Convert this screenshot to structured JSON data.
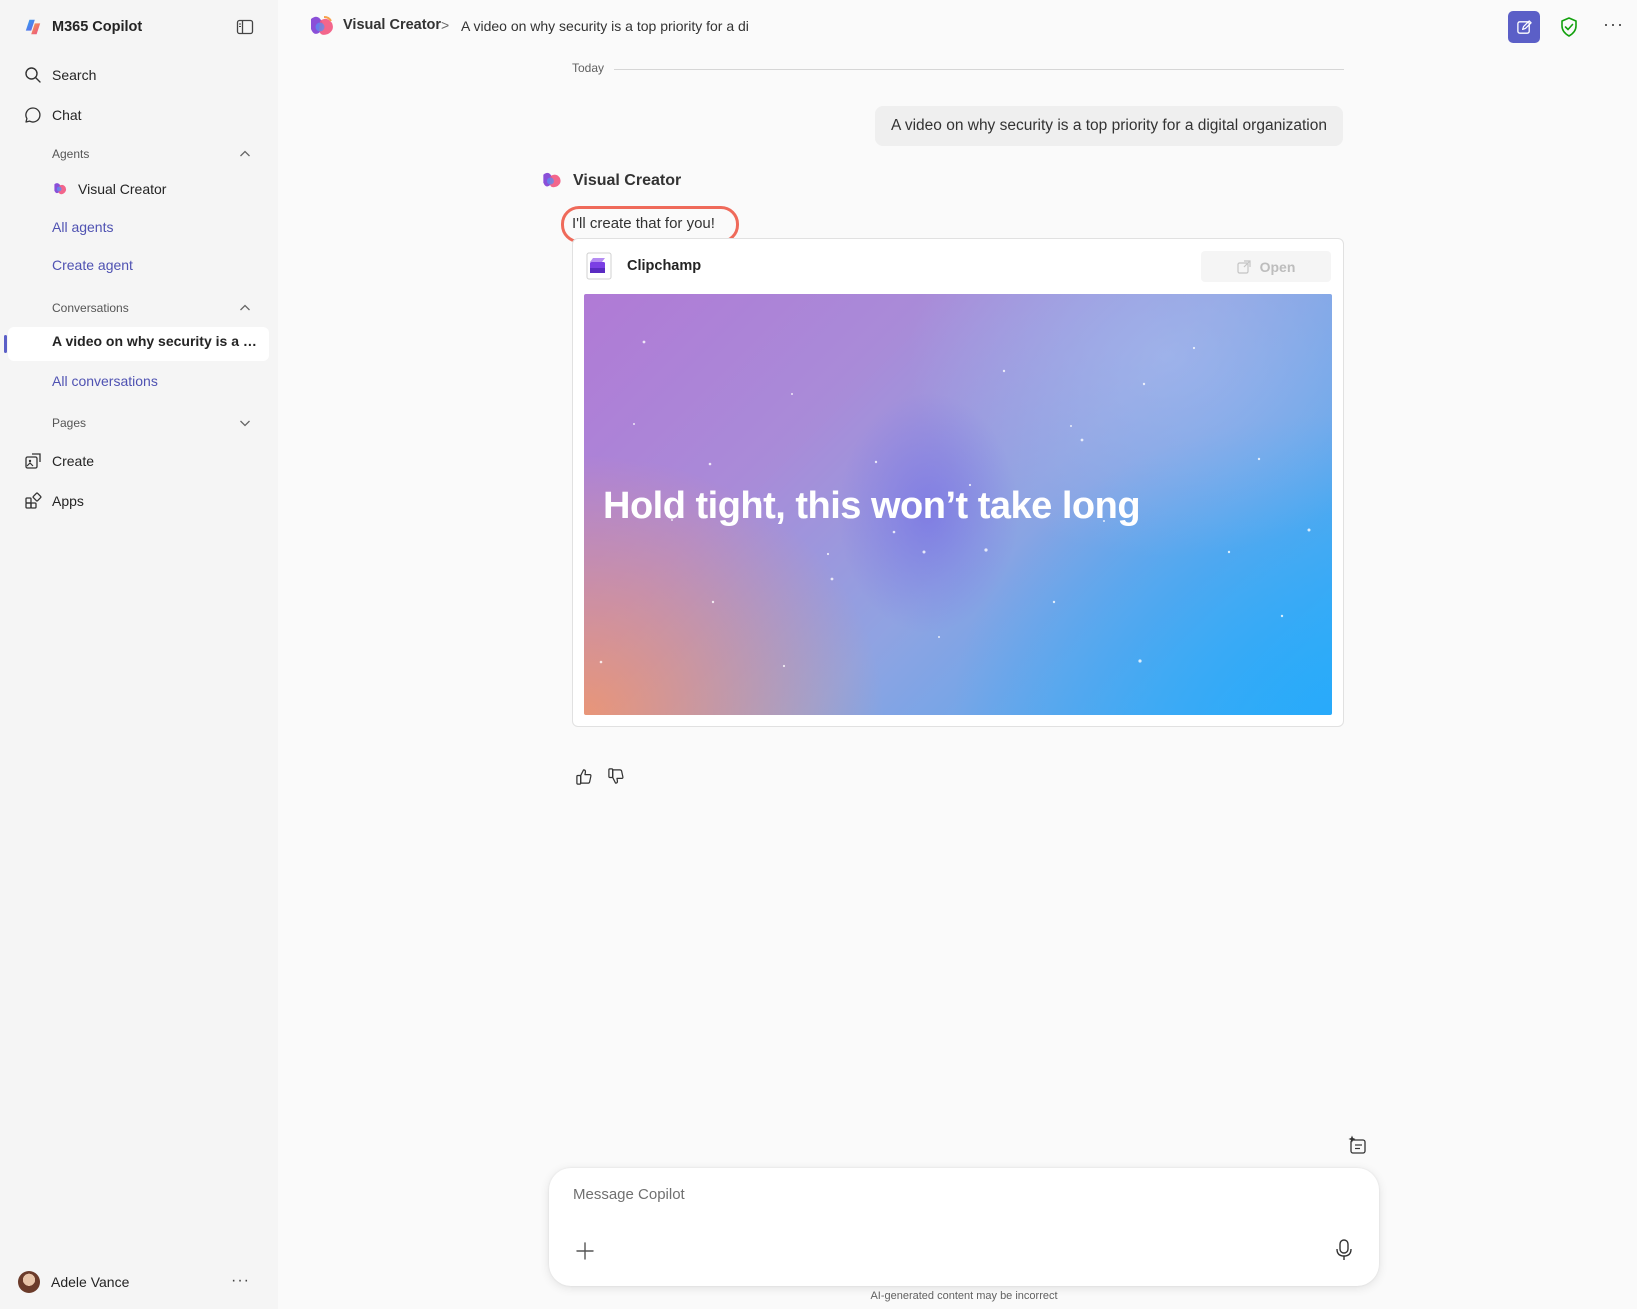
{
  "app": {
    "title": "M365 Copilot"
  },
  "nav": {
    "search": "Search",
    "chat": "Chat",
    "agents_label": "Agents",
    "agents": [
      "Visual Creator"
    ],
    "all_agents": "All agents",
    "create_agent": "Create agent",
    "conversations_label": "Conversations",
    "active_conversation": "A video on why security is a top priority for a digital organization",
    "all_conversations": "All conversations",
    "pages_label": "Pages",
    "create": "Create",
    "apps": "Apps"
  },
  "user": {
    "name": "Adele Vance"
  },
  "breadcrumb": {
    "agent": "Visual Creator",
    "separator": ">",
    "conversation": "A video on why security is a top priority for a di"
  },
  "chat": {
    "date_divider": "Today",
    "user_message": "A video on why security is a top priority for a digital organization",
    "agent_name": "Visual Creator",
    "agent_reply": "I'll create that for you!",
    "card": {
      "app_name": "Clipchamp",
      "open_label": "Open",
      "preview_text": "Hold tight, this won’t take long"
    }
  },
  "composer": {
    "placeholder": "Message Copilot",
    "disclaimer": "AI-generated content may be incorrect"
  },
  "icons": {
    "app_logo": "copilot-logo-icon",
    "collapse": "sidebar-toggle-icon",
    "search": "search-icon",
    "chat": "chat-bubble-icon",
    "create": "create-icon",
    "apps": "apps-grid-icon",
    "new_chat": "compose-icon",
    "shield": "shield-check-icon",
    "more": "more-horizontal-icon",
    "thumbs_up": "thumbs-up-icon",
    "thumbs_down": "thumbs-down-icon",
    "plus": "plus-icon",
    "mic": "microphone-icon"
  },
  "colors": {
    "accent": "#5b5fc7",
    "link": "#4f52b2",
    "highlight": "#ef6a5a",
    "shield": "#13a10e"
  }
}
